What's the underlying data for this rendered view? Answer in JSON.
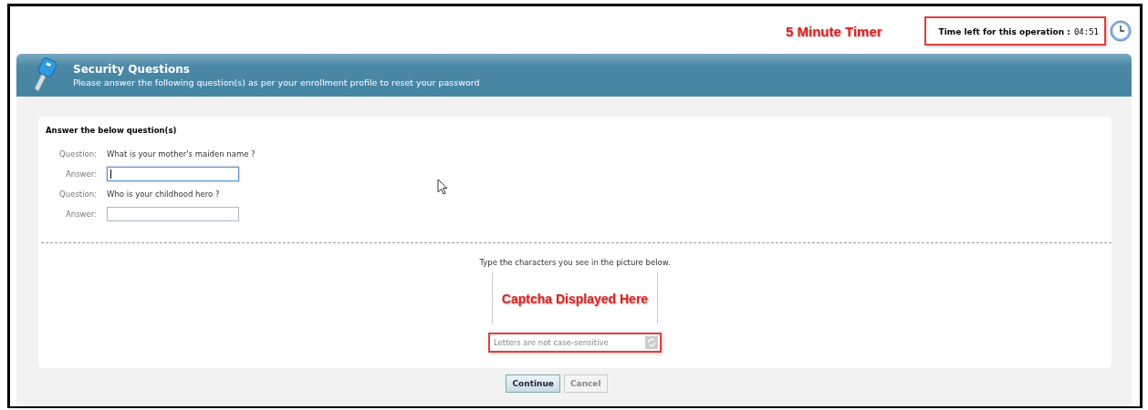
{
  "timer": {
    "annotation": "5 Minute Timer",
    "label": "Time left for this operation :",
    "value": "04:51"
  },
  "header": {
    "title": "Security Questions",
    "subtitle": "Please answer the following question(s) as per your enrollment profile to reset your password"
  },
  "form": {
    "heading": "Answer the below question(s)",
    "questions": [
      {
        "question_label": "Question:",
        "question": "What is your mother's maiden name ?",
        "answer_label": "Answer:",
        "focused": true
      },
      {
        "question_label": "Question:",
        "question": "Who is your childhood hero ?",
        "answer_label": "Answer:",
        "focused": false
      }
    ]
  },
  "captcha": {
    "instruction": "Type the characters you see in the picture below.",
    "annotation": "Captcha Displayed Here",
    "placeholder": "Letters are not case-sensitive"
  },
  "buttons": [
    {
      "label": "Continue",
      "kind": "primary"
    },
    {
      "label": "Cancel",
      "kind": "secondary"
    }
  ]
}
